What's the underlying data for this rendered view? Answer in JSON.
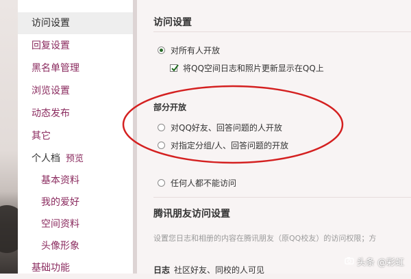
{
  "sidebar": {
    "items": [
      {
        "label": "访问设置"
      },
      {
        "label": "回复设置"
      },
      {
        "label": "黑名单管理"
      },
      {
        "label": "浏览设置"
      },
      {
        "label": "动态发布"
      },
      {
        "label": "其它"
      }
    ],
    "profile": {
      "label": "个人档",
      "preview": "预览"
    },
    "profile_items": [
      {
        "label": "基本资料"
      },
      {
        "label": "我的爱好"
      },
      {
        "label": "空间资料"
      },
      {
        "label": "头像形象"
      }
    ],
    "bottom_item": {
      "label": "基础功能"
    }
  },
  "main": {
    "section1_title": "访问设置",
    "options": {
      "all_open": "对所有人开放",
      "sync_qq": "将QQ空间日志和照片更新显示在QQ上",
      "partial_title": "部分开放",
      "qq_friends": "对QQ好友、回答问题的人开放",
      "groups": "对指定分组/人、回答问题的开放",
      "nobody": "任何人都不能访问"
    },
    "section2_title": "腾讯朋友访问设置",
    "section2_desc": "设置您日志和相册的内容在腾讯朋友（原QQ校友）的访问权限；方",
    "diary_label": "日志",
    "diary_value": "社区好友、同校的人可见"
  },
  "state": {
    "selected_option": "all_open",
    "sync_checked": true
  },
  "colors": {
    "link": "#8a2a5e",
    "annotation": "#d42020"
  },
  "watermark": {
    "text": "头条 @彩虹"
  }
}
